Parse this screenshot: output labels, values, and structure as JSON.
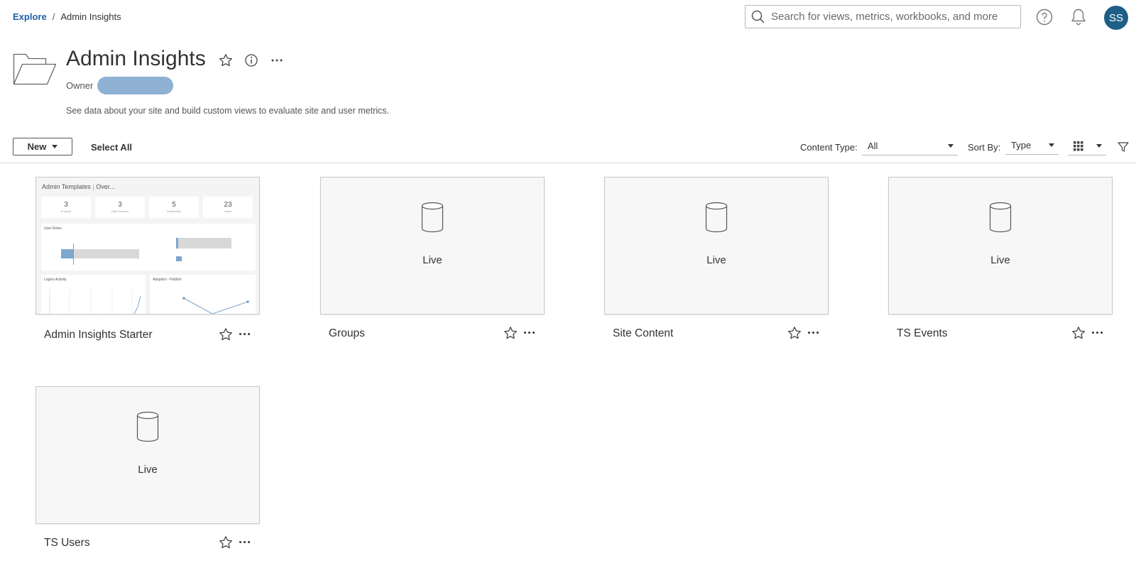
{
  "breadcrumb": {
    "root": "Explore",
    "separator": "/",
    "current": "Admin Insights"
  },
  "search": {
    "placeholder": "Search for views, metrics, workbooks, and more"
  },
  "user": {
    "initials": "SS"
  },
  "header": {
    "title": "Admin Insights",
    "owner_label": "Owner",
    "description": "See data about your site and build custom views to evaluate site and user metrics."
  },
  "toolbar": {
    "new_label": "New",
    "select_all_label": "Select All",
    "content_type_label": "Content Type:",
    "content_type_value": "All",
    "sort_by_label": "Sort By:",
    "sort_by_value": "Type"
  },
  "cards": [
    {
      "name": "Admin Insights Starter",
      "kind": "workbook",
      "thumbnail": {
        "title": "Admin Templates",
        "subtitle": "Over...",
        "stats": [
          {
            "value": "3",
            "label": "Projects"
          },
          {
            "value": "3",
            "label": "Data Sources"
          },
          {
            "value": "5",
            "label": "Workbooks"
          },
          {
            "value": "23",
            "label": "Views"
          }
        ],
        "panels": [
          "User Roles",
          "Logins Activity",
          "Adoption - Publish"
        ]
      }
    },
    {
      "name": "Groups",
      "kind": "datasource",
      "status": "Live"
    },
    {
      "name": "Site Content",
      "kind": "datasource",
      "status": "Live"
    },
    {
      "name": "TS Events",
      "kind": "datasource",
      "status": "Live"
    },
    {
      "name": "TS Users",
      "kind": "datasource",
      "status": "Live"
    }
  ],
  "icons": {
    "search": "search-icon",
    "help": "help-icon",
    "bell": "bell-icon",
    "folder": "folder-icon",
    "star": "star-icon",
    "info": "info-icon",
    "more": "more-icon",
    "database": "database-icon",
    "grid": "grid-view-icon",
    "filter": "filter-icon"
  },
  "colors": {
    "link": "#1f5fa8",
    "avatar": "#1e5f87",
    "owner_pill": "#8fb1d3"
  }
}
